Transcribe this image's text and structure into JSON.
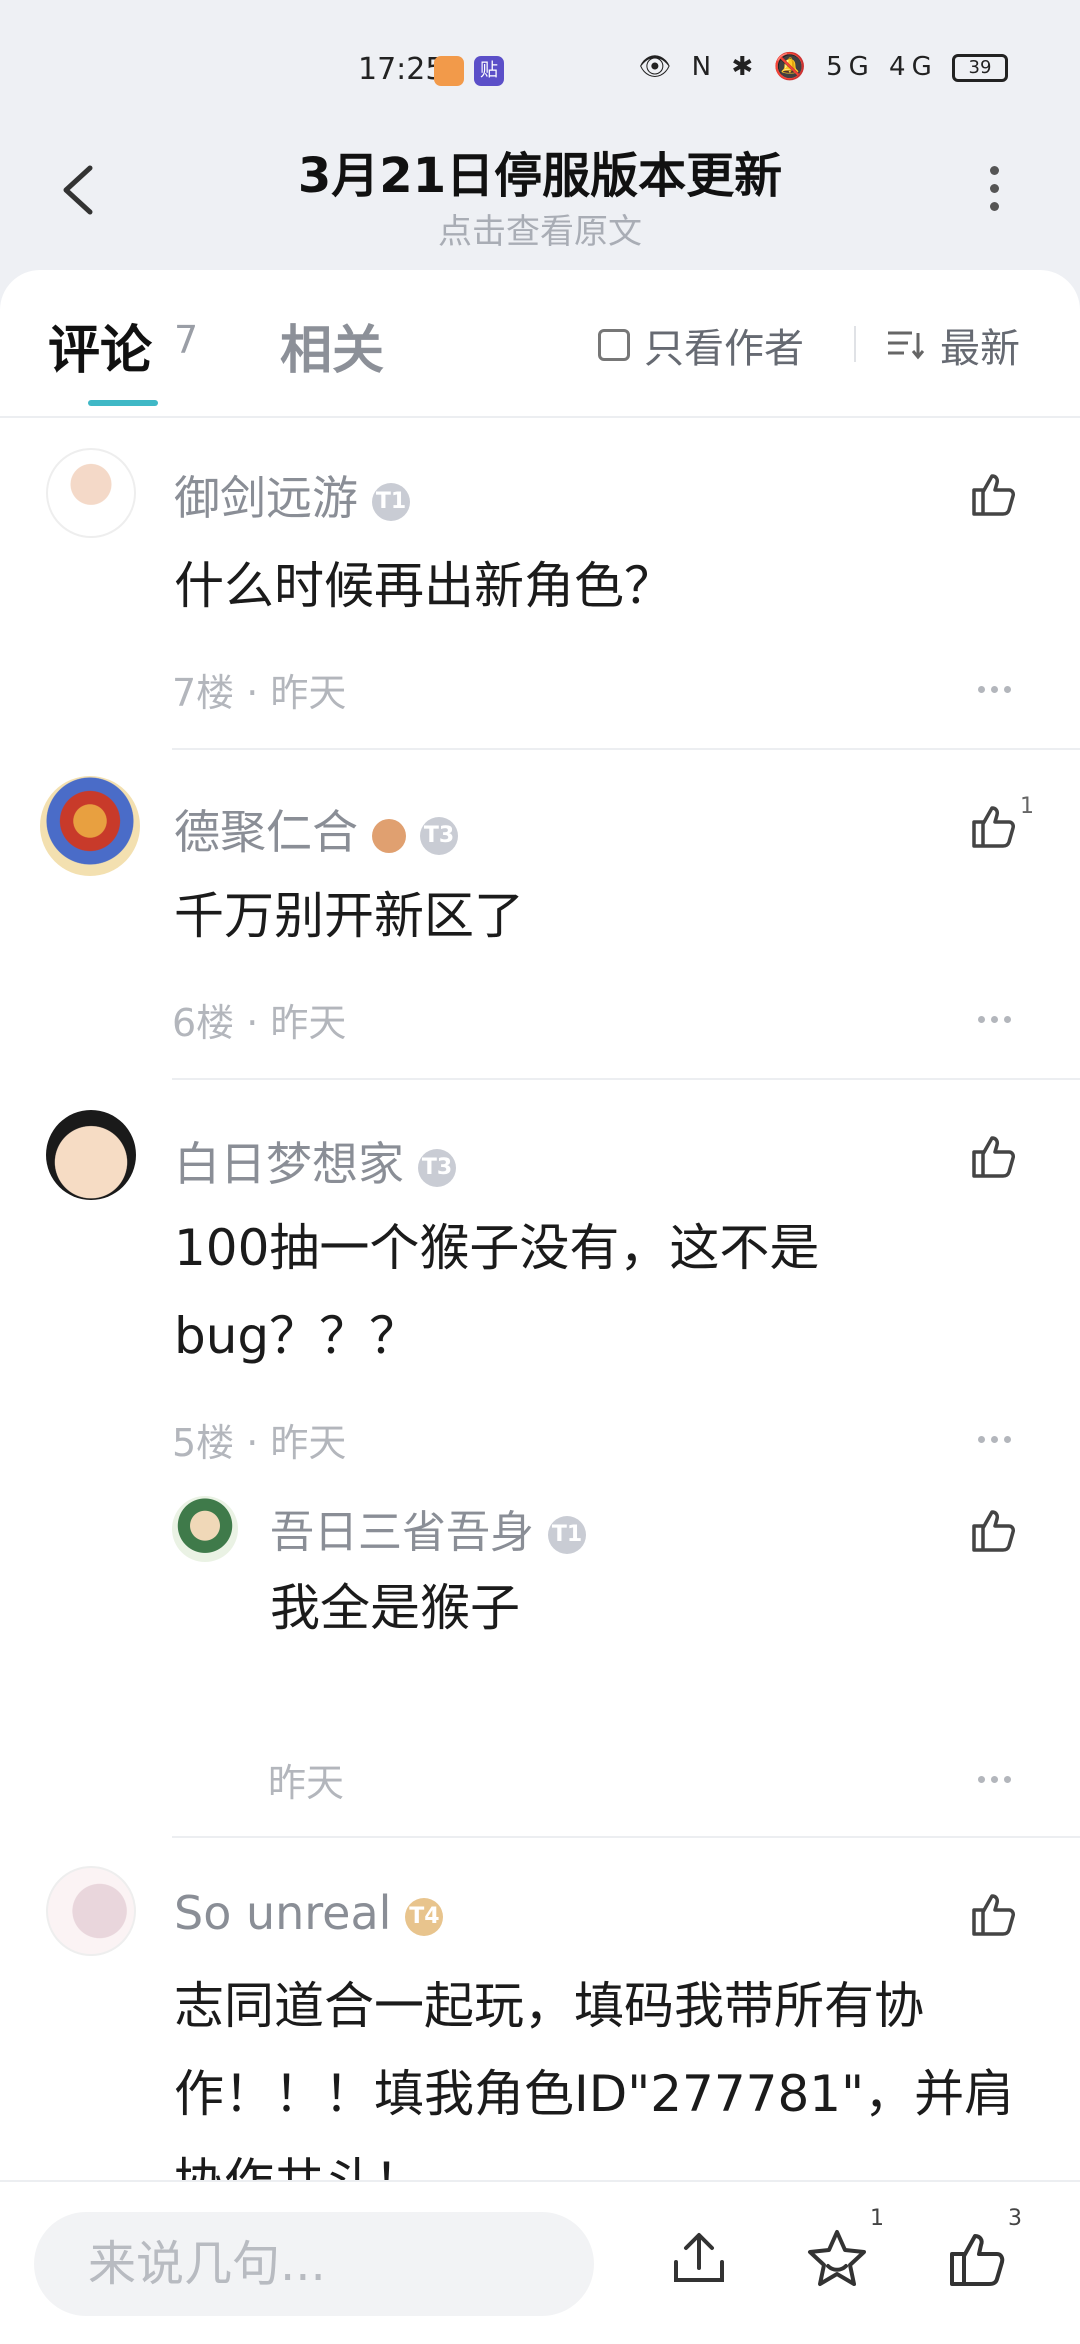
{
  "status_bar": {
    "time": "17:25",
    "app2_label": "贴",
    "right_text": "👁 N ✱ 🔕 5G 4G",
    "battery": "39"
  },
  "header": {
    "title": "3月21日停服版本更新",
    "subtitle": "点击查看原文"
  },
  "tabs": {
    "comments_label": "评论",
    "comments_count": "7",
    "related_label": "相关",
    "author_only_label": "只看作者",
    "sort_label": "最新"
  },
  "comments": [
    {
      "username": "御剑远游",
      "badge": "T1",
      "text": "什么时候再出新角色？",
      "meta": "7楼 · 昨天",
      "like_count": ""
    },
    {
      "username": "德聚仁合",
      "badge": "T3",
      "text": "千万别开新区了",
      "meta": "6楼 · 昨天",
      "like_count": "1"
    },
    {
      "username": "白日梦想家",
      "badge": "T3",
      "text": "100抽一个猴子没有，这不是bug？？？",
      "meta": "5楼 · 昨天",
      "like_count": ""
    },
    {
      "username": "So unreal",
      "badge": "T4",
      "text": "志同道合一起玩，填码我带所有协作！！！填我角色ID\"277781\"，并肩协作共斗！",
      "meta": "",
      "like_count": ""
    }
  ],
  "reply": {
    "username": "吾日三省吾身",
    "badge": "T1",
    "text": "我全是猴子",
    "meta": "昨天"
  },
  "bottom_bar": {
    "input_placeholder": "来说几句...",
    "star_count": "1",
    "like_count": "3"
  },
  "colors": {
    "accent": "#3fb8c6",
    "background": "#eef0f4",
    "muted_text": "#8a8e96"
  }
}
